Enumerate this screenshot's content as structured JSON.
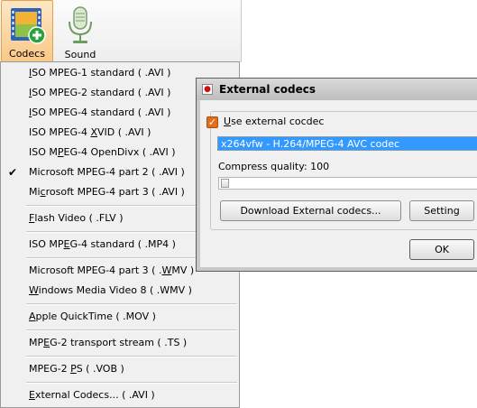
{
  "toolbar": {
    "codecs_label": "Codecs",
    "sound_label": "Sound",
    "codecs_icon": "film-plus-icon",
    "sound_icon": "microphone-icon"
  },
  "menu": {
    "items": [
      {
        "pre": "",
        "u": "I",
        "post": "SO MPEG-1 standard ( .AVI )",
        "checked": false
      },
      {
        "pre": "",
        "u": "I",
        "post": "SO MPEG-2 standard ( .AVI )",
        "checked": false
      },
      {
        "pre": "",
        "u": "I",
        "post": "SO MPEG-4 standard ( .AVI )",
        "checked": false
      },
      {
        "pre": "ISO MPEG-4 ",
        "u": "X",
        "post": "VID ( .AVI )",
        "checked": false
      },
      {
        "pre": "ISO M",
        "u": "P",
        "post": "EG-4 OpenDivx ( .AVI )",
        "checked": false
      },
      {
        "pre": "Microsoft MPEG-4 part 2 ( .AVI )",
        "u": "",
        "post": "",
        "checked": true
      },
      {
        "pre": "Mi",
        "u": "c",
        "post": "rosoft MPEG-4 part 3 ( .AVI )",
        "checked": false
      },
      {
        "pre": "",
        "u": "F",
        "post": "lash Video ( .FLV )",
        "checked": false
      },
      {
        "pre": "ISO MP",
        "u": "E",
        "post": "G-4 standard ( .MP4 )",
        "checked": false
      },
      {
        "pre": "Microsoft MPEG-4 part 3 ( .",
        "u": "W",
        "post": "MV )",
        "checked": false
      },
      {
        "pre": "",
        "u": "W",
        "post": "indows Media Video 8 ( .WMV )",
        "checked": false
      },
      {
        "pre": "",
        "u": "A",
        "post": "pple QuickTime ( .MOV )",
        "checked": false
      },
      {
        "pre": "MP",
        "u": "E",
        "post": "G-2 transport stream ( .TS )",
        "checked": false
      },
      {
        "pre": "MPEG-2 ",
        "u": "P",
        "post": "S ( .VOB )",
        "checked": false
      },
      {
        "pre": "",
        "u": "E",
        "post": "xternal Codecs... ( .AVI )",
        "checked": false
      }
    ]
  },
  "dialog": {
    "title": "External codecs",
    "use_external_pre": "",
    "use_external_u": "U",
    "use_external_post": "se external cocdec",
    "use_external_checked": true,
    "selected_codec": "x264vfw - H.264/MPEG-4 AVC codec",
    "compress_quality_label": "Compress quality: 100",
    "compress_quality_value": 100,
    "download_button": "Download External codecs...",
    "setting_button": "Setting",
    "ok_button": "OK",
    "accent_color": "#3399ff",
    "checkbox_color": "#e46d1c"
  }
}
